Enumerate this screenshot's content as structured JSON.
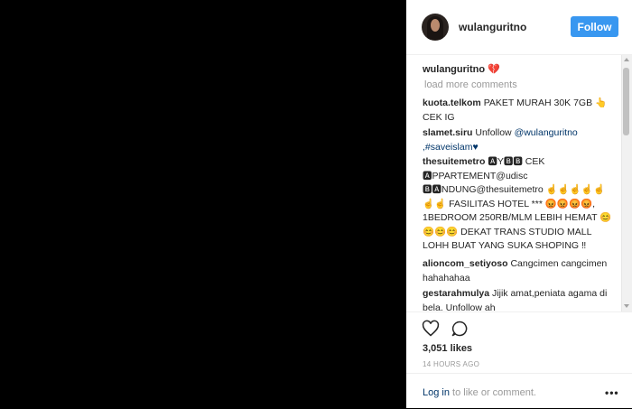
{
  "post": {
    "username": "wulanguritno",
    "follow_label": "Follow"
  },
  "caption": {
    "username": "wulanguritno",
    "emoji": "💔"
  },
  "comments": {
    "load_more": "load more comments",
    "items": [
      {
        "user": "kuota.telkom",
        "text": "PAKET MURAH 30K 7GB 👆CEK IG"
      },
      {
        "user": "slamet.siru",
        "text": "Unfollow ",
        "mention": "@wulanguritno ,#saveislam♥"
      },
      {
        "user": "thesuitemetro",
        "text": "🅰Y🅱🅱 CEK 🅰PPARTEMENT@udisc 🅱🅰NDUNG@thesuitemetro ☝☝☝☝☝☝☝ FASILITAS HOTEL *** 😡😡😡😡, 1BEDROOM 250RB/MLM LEBIH HEMAT 😊😊😊😊 DEKAT TRANS STUDIO MALL LOHH BUAT YANG SUKA SHOPING ‼"
      },
      {
        "user": "alioncom_setiyoso",
        "text": "Cangcimen cangcimen hahahahaa"
      },
      {
        "user": "gestarahmulya",
        "text": "Jijik amat,peniata agama di bela. Unfollow ah"
      }
    ]
  },
  "actions": {
    "likes": "3,051 likes",
    "time": "14 HOURS AGO"
  },
  "footer": {
    "login_link": "Log in",
    "login_text": " to like or comment.",
    "more": "•••"
  }
}
